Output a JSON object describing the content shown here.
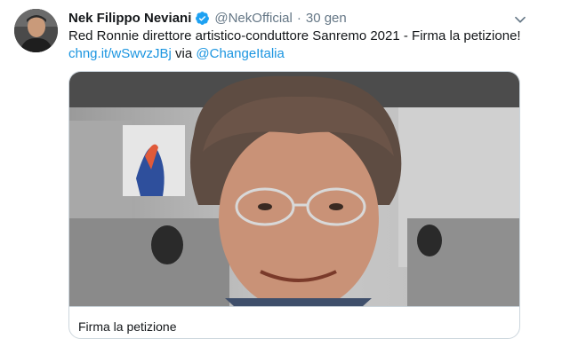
{
  "tweet": {
    "author_name": "Nek Filippo Neviani",
    "handle": "@NekOfficial",
    "separator": "·",
    "timestamp": "30 gen",
    "text_before": "Red Ronnie direttore artistico-conduttore Sanremo 2021 - Firma la petizione! ",
    "short_link": "chng.it/wSwvzJBj",
    "text_via": " via ",
    "mention": "@ChangeItalia",
    "verified_icon": "verified-badge-icon",
    "menu_icon": "chevron-down-icon",
    "accent_color": "#1b95e0"
  },
  "card": {
    "title": "Firma la petizione"
  }
}
